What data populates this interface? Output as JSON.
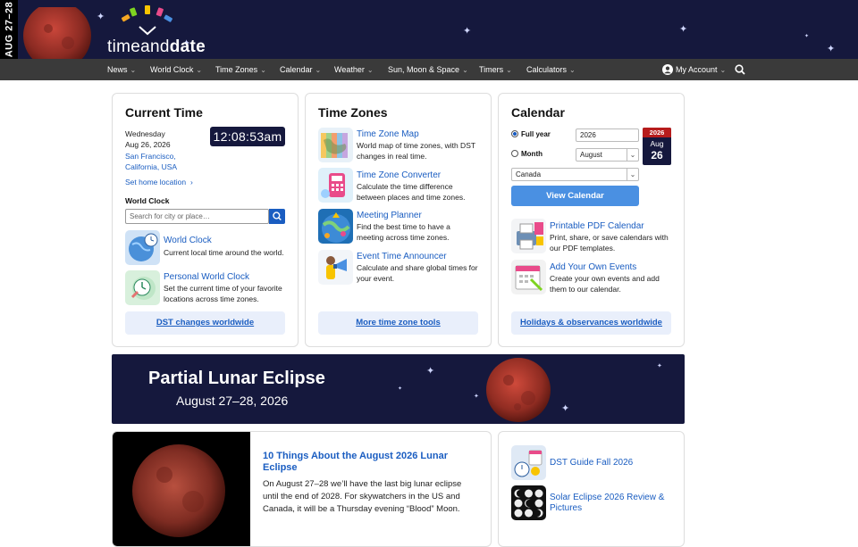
{
  "banner": {
    "vertical_date": "AUG 27–28",
    "logo_text_light": "timeand",
    "logo_text_bold": "date"
  },
  "nav": {
    "items": [
      "News",
      "World Clock",
      "Time Zones",
      "Calendar",
      "Weather",
      "Sun, Moon & Space",
      "Timers",
      "Calculators"
    ],
    "account": "My Account"
  },
  "current_time": {
    "heading": "Current Time",
    "weekday": "Wednesday",
    "date": "Aug 26, 2026",
    "location_line1": "San Francisco,",
    "location_line2": "California, USA",
    "clock": "12:08:53am",
    "set_home": "Set home location",
    "world_clock_heading": "World Clock",
    "search_placeholder": "Search for city or place…",
    "items": [
      {
        "title": "World Clock",
        "desc": "Current local time around the world."
      },
      {
        "title": "Personal World Clock",
        "desc_line1": "Set the current time of your favorite",
        "desc_line2": "locations across time zones."
      }
    ],
    "button": "DST changes worldwide"
  },
  "time_zones": {
    "heading": "Time Zones",
    "items": [
      {
        "title": "Time Zone Map",
        "desc_line1": "World map of time zones, with DST",
        "desc_line2": "changes in real time."
      },
      {
        "title": "Time Zone Converter",
        "desc_line1": "Calculate the time difference",
        "desc_line2": "between places and time zones."
      },
      {
        "title": "Meeting Planner",
        "desc_line1": "Find the best time to have a",
        "desc_line2": "meeting across time zones."
      },
      {
        "title": "Event Time Announcer",
        "desc_line1": "Calculate and share global times for",
        "desc_line2": "your event."
      }
    ],
    "button": "More time zone tools"
  },
  "calendar": {
    "heading": "Calendar",
    "full_year_label": "Full year",
    "month_label": "Month",
    "year_value": "2026",
    "month_value": "August",
    "country_value": "Canada",
    "badge_year": "2026",
    "badge_month": "Aug",
    "badge_day": "26",
    "view_button": "View Calendar",
    "items": [
      {
        "title": "Printable PDF Calendar",
        "desc_line1": "Print, share, or save calendars with",
        "desc_line2": "our PDF templates."
      },
      {
        "title": "Add Your Own Events",
        "desc_line1": "Create your own events and add",
        "desc_line2": "them to our calendar."
      }
    ],
    "button": "Holidays & observances worldwide"
  },
  "eclipse": {
    "title": "Partial Lunar Eclipse",
    "dates": "August 27–28, 2026"
  },
  "article": {
    "title_line1": "10 Things About the August 2026 Lunar",
    "title_line2": "Eclipse",
    "body_line1": "On August 27–28 we’ll have the last big lunar eclipse",
    "body_line2": "until the end of 2028. For skywatchers in the US and",
    "body_line3": "Canada, it will be a Thursday evening “Blood” Moon."
  },
  "side_links": [
    {
      "title": "DST Guide Fall 2026"
    },
    {
      "title_line1": "Solar Eclipse 2026 Review &",
      "title_line2": "Pictures"
    }
  ],
  "colors": {
    "navy": "#15183d",
    "link": "#1a5dc1",
    "nav_bg": "#3a3a3a",
    "button_blue": "#4a90e2",
    "badge_red": "#b71c1c"
  }
}
